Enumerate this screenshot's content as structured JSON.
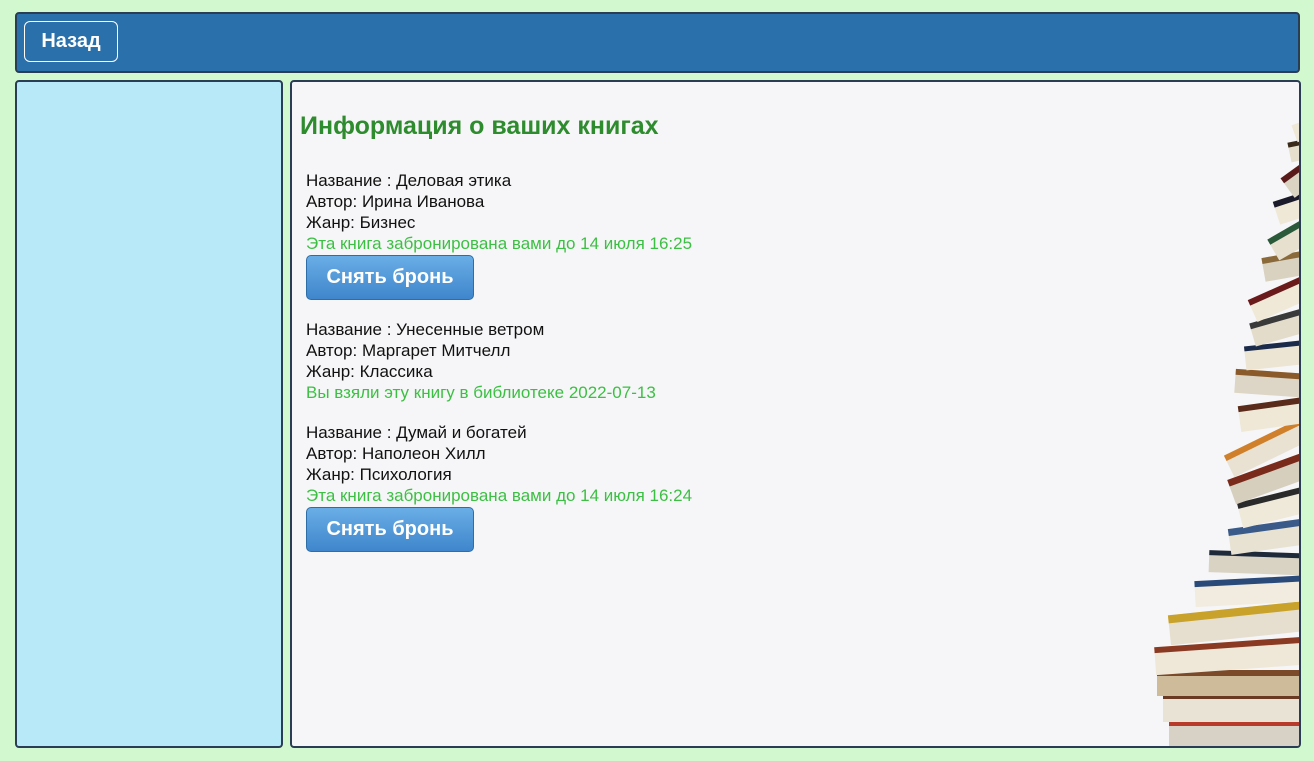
{
  "header": {
    "back_label": "Назад"
  },
  "main": {
    "title": "Информация о ваших книгах",
    "books": [
      {
        "title_line": "Название : Деловая этика",
        "author_line": "Автор: Ирина Иванова",
        "genre_line": "Жанр: Бизнес",
        "status": "Эта книга забронирована вами до 14 июля 16:25",
        "button_label": "Снять бронь"
      },
      {
        "title_line": "Название : Унесенные ветром",
        "author_line": "Автор: Маргарет Митчелл",
        "genre_line": "Жанр: Классика",
        "status": "Вы взяли эту книгу в библиотеке 2022-07-13"
      },
      {
        "title_line": "Название : Думай и богатей",
        "author_line": "Автор: Наполеон Хилл",
        "genre_line": "Жанр: Психология",
        "status": "Эта книга забронирована вами до 14 июля 16:24",
        "button_label": "Снять бронь"
      }
    ]
  },
  "colors": {
    "page_bg": "#d2f8d0",
    "header_bg": "#2a70aa",
    "sidebar_bg": "#b8e9f8",
    "title_color": "#2e8b2e",
    "status_color": "#3cc043",
    "button_color": "#4a90d4"
  }
}
